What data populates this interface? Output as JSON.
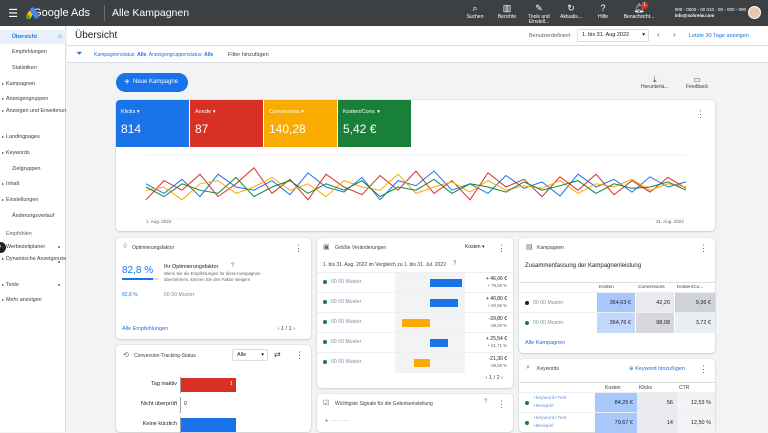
{
  "topbar": {
    "product": "Google Ads",
    "account": "Alle Kampagnen",
    "tools": [
      {
        "icon": "search-icon",
        "label": "Suchen"
      },
      {
        "icon": "reports-icon",
        "label": "Berichte"
      },
      {
        "icon": "tools-icon",
        "label": "Tools und Einstell..."
      },
      {
        "icon": "refresh-icon",
        "label": "Aktualis..."
      },
      {
        "icon": "help-icon",
        "label": "Hilfe"
      },
      {
        "icon": "bell-icon",
        "label": "Benachricht..."
      }
    ],
    "notification_count": "1",
    "customer_id": "000 - 0000 - 00 010 · 00 - 000 - 000",
    "customer_email": "info@schreiw.com"
  },
  "sidebar": {
    "items": [
      {
        "label": "Übersicht",
        "active": true
      },
      {
        "label": "Empfehlungen",
        "sub": true
      },
      {
        "label": "Statistiken",
        "sub": true
      },
      {
        "label": "Kampagnen"
      },
      {
        "label": "Anzeigengruppen"
      },
      {
        "label": "Anzeigen und Erweiterungen",
        "two": true
      },
      {
        "label": "Landingpages"
      },
      {
        "label": "Keywords"
      },
      {
        "label": "Zielgruppen",
        "sub": true
      },
      {
        "label": "Inhalt"
      },
      {
        "label": "Einstellungen"
      },
      {
        "label": "Änderungsverlauf",
        "sub": true
      }
    ],
    "group_label": "Empfohlen",
    "rec_items": [
      {
        "label": "Werbezeitplaner"
      },
      {
        "label": "Dynamische Anzeigenziele",
        "two": true
      },
      {
        "label": "Texte"
      },
      {
        "label": "Mehr anzeigen"
      }
    ]
  },
  "header": {
    "title": "Übersicht",
    "date_label": "Benutzerdefiniert",
    "date_range": "1. bis 31. Aug 2022",
    "last30": "Letzte 30 Tage anzeigen"
  },
  "filters": {
    "campaign_status_label": "Kampagnenstatus:",
    "campaign_status_value": "Alle",
    "adgroup_status_label": "Anzeigengruppenstatus:",
    "adgroup_status_value": "Alle",
    "add_filter": "Filter hinzufügen"
  },
  "actions": {
    "new_campaign": "Neue Kampagne",
    "download": "Herunterla...",
    "feedback": "Feedback"
  },
  "metrics": [
    {
      "label": "Klicks",
      "value": "814",
      "color": "#1a73e8"
    },
    {
      "label": "Anrufe",
      "value": "87",
      "color": "#d93025"
    },
    {
      "label": "Conversions",
      "value": "140,28",
      "color": "#f9ab00"
    },
    {
      "label": "Kosten/Conv.",
      "value": "5,42 €",
      "color": "#188038"
    }
  ],
  "chart_data": {
    "type": "line",
    "x_start": "1. Aug. 2022",
    "x_end": "31. Aug. 2022",
    "series": [
      {
        "name": "Klicks",
        "color": "#1a73e8",
        "values": [
          0.55,
          0.4,
          0.62,
          0.35,
          0.7,
          0.5,
          0.45,
          0.6,
          0.38,
          0.72,
          0.5,
          0.42,
          0.65,
          0.3,
          0.6,
          0.52,
          0.75,
          0.45,
          0.55,
          0.4,
          0.68,
          0.48,
          0.58,
          0.36,
          0.7,
          0.5,
          0.62,
          0.42,
          0.66,
          0.5,
          0.58
        ]
      },
      {
        "name": "Anrufe",
        "color": "#d93025",
        "values": [
          0.3,
          0.6,
          0.45,
          0.7,
          0.35,
          0.55,
          0.8,
          0.4,
          0.62,
          0.3,
          0.7,
          0.5,
          0.38,
          0.68,
          0.45,
          0.75,
          0.4,
          0.6,
          0.3,
          0.72,
          0.5,
          0.62,
          0.35,
          0.66,
          0.45,
          0.7,
          0.38,
          0.6,
          0.42,
          0.65,
          0.48
        ]
      },
      {
        "name": "Conversions",
        "color": "#f9ab00",
        "values": [
          0.45,
          0.5,
          0.3,
          0.55,
          0.6,
          0.4,
          0.5,
          0.65,
          0.45,
          0.55,
          0.35,
          0.6,
          0.5,
          0.45,
          0.7,
          0.4,
          0.5,
          0.58,
          0.42,
          0.6,
          0.45,
          0.52,
          0.48,
          0.6,
          0.4,
          0.55,
          0.5,
          0.62,
          0.45,
          0.55,
          0.5
        ]
      },
      {
        "name": "Kosten/Conv.",
        "color": "#188038",
        "values": [
          0.5,
          0.35,
          0.55,
          0.45,
          0.4,
          0.65,
          0.35,
          0.5,
          0.6,
          0.4,
          0.55,
          0.45,
          0.6,
          0.35,
          0.5,
          0.45,
          0.62,
          0.4,
          0.55,
          0.5,
          0.42,
          0.58,
          0.45,
          0.52,
          0.6,
          0.4,
          0.55,
          0.48,
          0.5,
          0.58,
          0.45
        ]
      }
    ]
  },
  "opt": {
    "title": "Optimierungsfaktor",
    "score": "82,8 %",
    "score_fraction": 0.828,
    "heading": "Ihr Optimierungsfaktor",
    "text": "Wenn Sie die Empfehlungen für diese Kampagnen übernehmen, können Sie den Faktor steigern",
    "pct": "82,8 %",
    "campaign": "00 00 Muster",
    "link": "Alle Empfehlungen",
    "pager": "1 / 1"
  },
  "changes": {
    "title": "Größte Veränderungen",
    "metric": "Kosten",
    "subtitle": "1. bis 31. Aug. 2022 im Vergleich zu 1. bis 31. Jul. 2022",
    "rows": [
      {
        "name": "00 00 Muster",
        "v1": "+ 46,66 €",
        "v2": "+ 79,50 %",
        "dir": 1,
        "mag": 0.9
      },
      {
        "name": "00 00 Muster",
        "v1": "+ 40,80 €",
        "v2": "+ 60,50 %",
        "dir": 1,
        "mag": 0.8
      },
      {
        "name": "00 00 Muster",
        "v1": "-39,80 €",
        "v2": "-39,00 %",
        "dir": -1,
        "mag": 0.8
      },
      {
        "name": "00 00 Muster",
        "v1": "+ 25,54 €",
        "v2": "+ 51,71 %",
        "dir": 1,
        "mag": 0.5
      },
      {
        "name": "00 00 Muster",
        "v1": "-21,30 €",
        "v2": "-29,50 %",
        "dir": -1,
        "mag": 0.45
      }
    ],
    "pager": "1 / 2"
  },
  "campaigns": {
    "title": "Kampagnen",
    "summary": "Zusammenfassung der Kampagnenleistung",
    "cols": [
      "Kosten",
      "Conversions",
      "Kosten/Co..."
    ],
    "rows": [
      {
        "name": "00 00 Muster",
        "status": "#202124",
        "cost": "364,63 €",
        "conv": "42,20",
        "cpc": "9,36 €"
      },
      {
        "name": "00 00 Muster",
        "status": "#188038",
        "cost": "364,76 €",
        "conv": "98,08",
        "cpc": "3,72 €"
      }
    ],
    "link": "Alle Kampagnen"
  },
  "conversion": {
    "title": "Conversion-Tracking-Status",
    "filter": "Alle",
    "bars": [
      {
        "label": "Tag inaktiv",
        "value": "1",
        "fraction": 1,
        "color": "#d93025"
      },
      {
        "label": "Nicht überprüft",
        "value": "0",
        "fraction": 0,
        "color": "#f9ab00"
      },
      {
        "label": "Keine kürzlich",
        "value": "",
        "fraction": 1,
        "color": "#1a73e8"
      }
    ]
  },
  "signals": {
    "title": "Wichtigste Signale für die Gebotseinstellung"
  },
  "keywords": {
    "title": "Keywords",
    "add": "Keyword hinzufügen",
    "cols": [
      "Kosten",
      "Klicks",
      "CTR"
    ],
    "rows": [
      {
        "name": "+keyword+Test",
        "sub": "+Beispiel",
        "cost": "84,25 €",
        "clicks": "56",
        "ctr": "12,53 %"
      },
      {
        "name": "+keyword+Test",
        "sub": "+Beispiel",
        "cost": "79,67 €",
        "clicks": "14",
        "ctr": "12,50 %"
      }
    ]
  }
}
